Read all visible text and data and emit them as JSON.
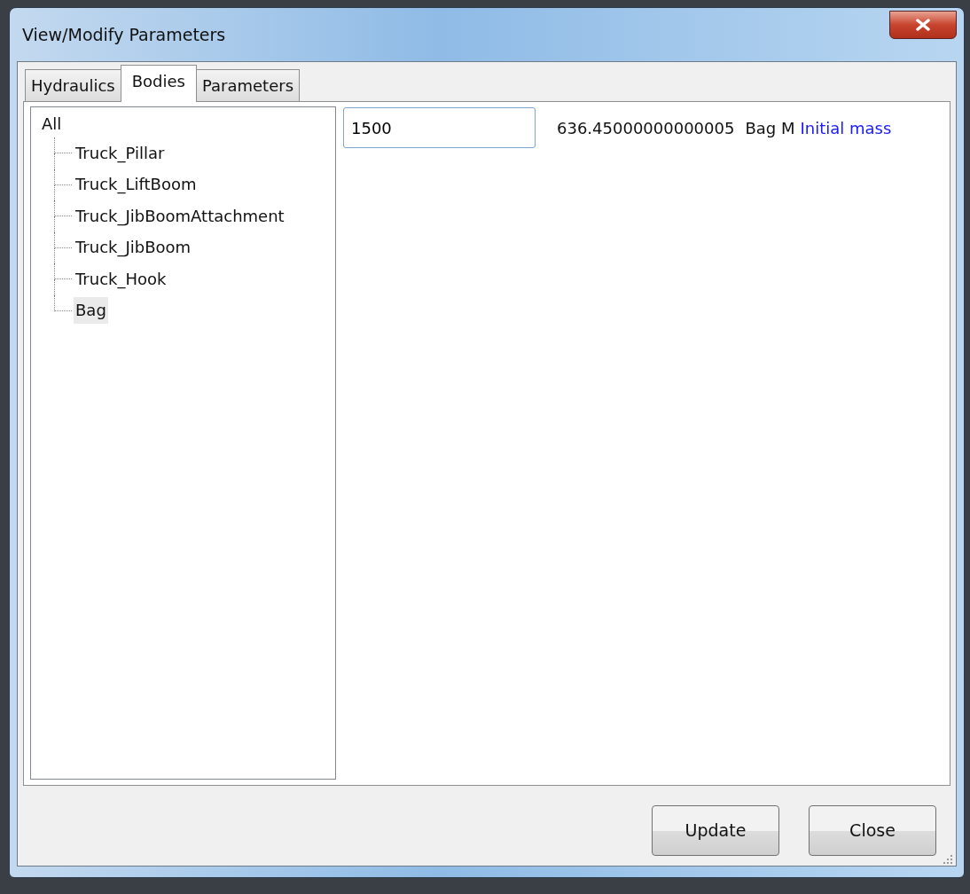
{
  "window": {
    "title": "View/Modify Parameters"
  },
  "tabs": [
    {
      "label": "Hydraulics",
      "selected": false
    },
    {
      "label": "Bodies",
      "selected": true
    },
    {
      "label": "Parameters",
      "selected": false
    }
  ],
  "tree": {
    "label": "All",
    "children": [
      {
        "label": "Truck_Pillar",
        "selected": false
      },
      {
        "label": "Truck_LiftBoom",
        "selected": false
      },
      {
        "label": "Truck_JibBoomAttachment",
        "selected": false
      },
      {
        "label": "Truck_JibBoom",
        "selected": false
      },
      {
        "label": "Truck_Hook",
        "selected": false
      },
      {
        "label": "Bag",
        "selected": true
      }
    ]
  },
  "parameter": {
    "value": "1500",
    "current": "636.45000000000005",
    "name": "Bag M",
    "description": "Initial mass"
  },
  "buttons": [
    "Update",
    "Close"
  ]
}
